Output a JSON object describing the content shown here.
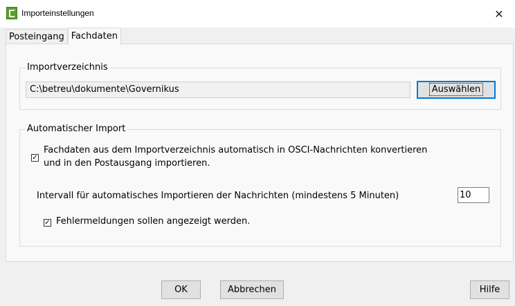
{
  "window": {
    "title": "Importeinstellungen",
    "close_label": "✕"
  },
  "tabs": [
    {
      "label": "Posteingang"
    },
    {
      "label": "Fachdaten"
    }
  ],
  "import_dir": {
    "group_title": "Importverzeichnis",
    "path_value": "C:\\betreu\\dokumente\\Governikus",
    "select_button": "Auswählen"
  },
  "auto_import": {
    "group_title": "Automatischer Import",
    "convert_checkbox": {
      "checked": true,
      "label_line1": "Fachdaten aus dem Importverzeichnis automatisch in OSCI-Nachrichten konvertieren",
      "label_line2": "und in den Postausgang importieren."
    },
    "interval_label": "Intervall für automatisches Importieren der Nachrichten (mindestens 5 Minuten)",
    "interval_value": "10",
    "errors_checkbox": {
      "checked": true,
      "label": "Fehlermeldungen sollen angezeigt werden."
    }
  },
  "footer": {
    "ok": "OK",
    "cancel": "Abbrechen",
    "help": "Hilfe"
  }
}
